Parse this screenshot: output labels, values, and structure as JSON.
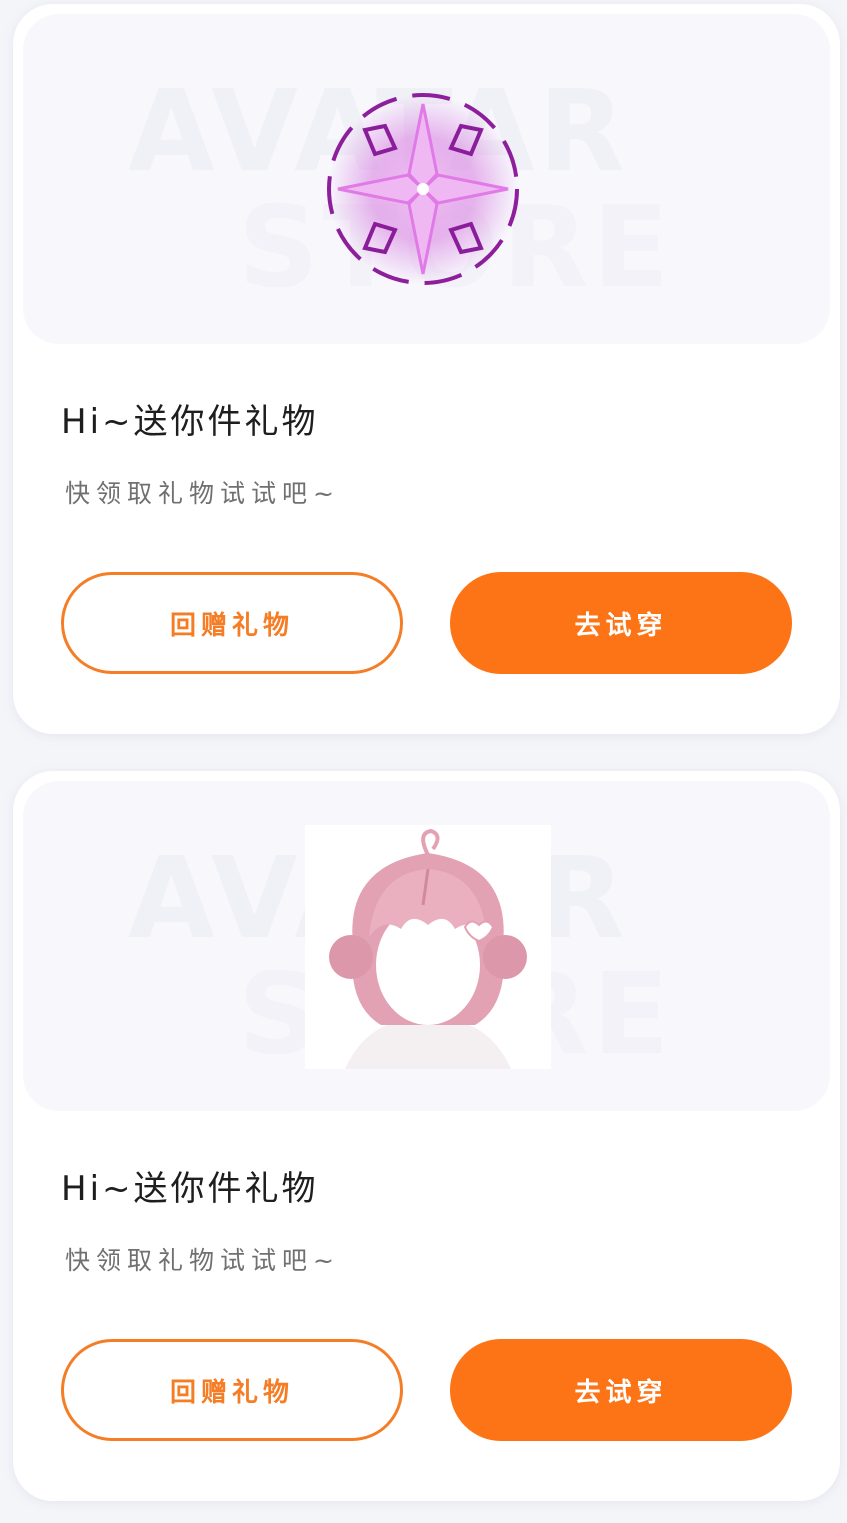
{
  "watermark": {
    "line1": "AVATAR",
    "line2": "STORE"
  },
  "gifts": [
    {
      "item_image": "purple-rune-emblem",
      "title": "Hi~送你件礼物",
      "subtitle": "快领取礼物试试吧~",
      "return_gift_label": "回赠礼物",
      "try_on_label": "去试穿"
    },
    {
      "item_image": "pink-bun-hairstyle",
      "title": "Hi~送你件礼物",
      "subtitle": "快领取礼物试试吧~",
      "return_gift_label": "回赠礼物",
      "try_on_label": "去试穿"
    }
  ],
  "colors": {
    "accent": "#fd7416",
    "outline": "#f47d25",
    "page_bg": "#f4f5f9",
    "card_bg": "#ffffff",
    "banner_bg": "#f7f7fc"
  }
}
